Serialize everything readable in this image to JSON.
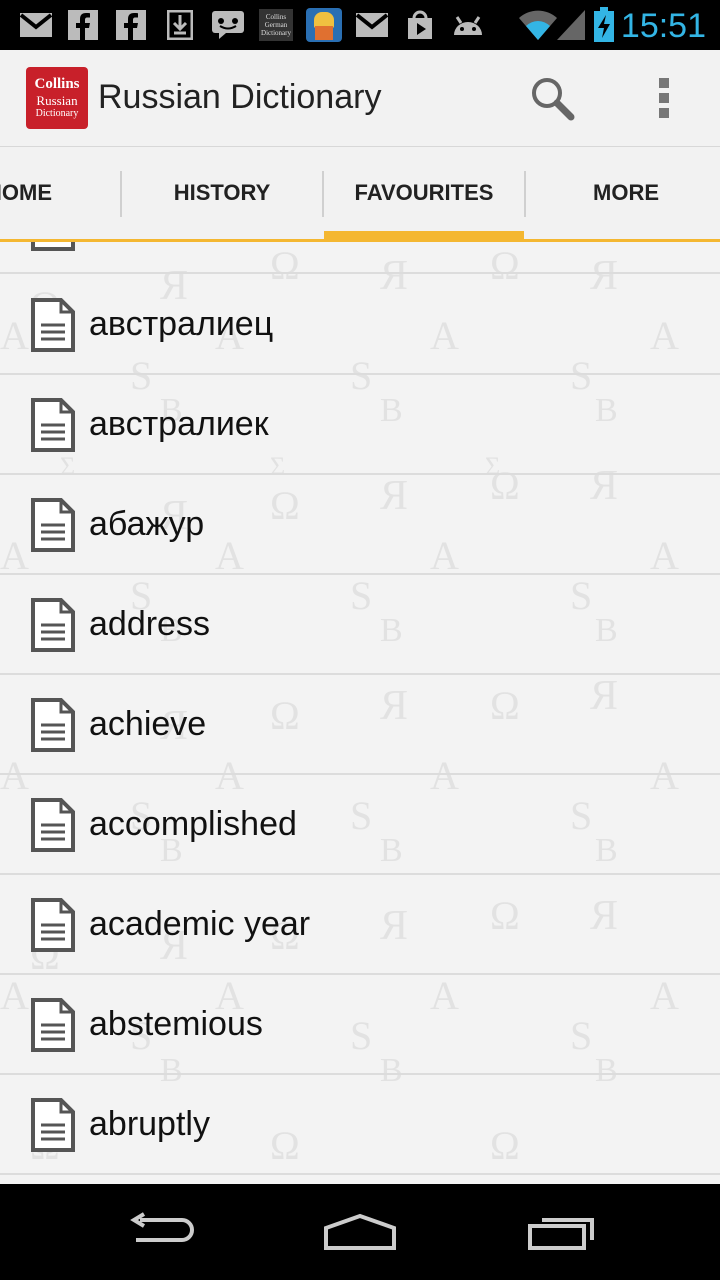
{
  "status_bar": {
    "time": "15:51",
    "notification_icons": [
      "gmail-icon",
      "facebook-icon",
      "facebook-icon",
      "download-icon",
      "chat-icon",
      "collins-german-icon",
      "game-icon",
      "gmail-icon",
      "play-store-icon",
      "android-icon"
    ],
    "collins_icon_text": [
      "Collins",
      "German",
      "Dictionary"
    ]
  },
  "action_bar": {
    "logo": {
      "line1": "Collins",
      "line2": "Russian",
      "line3": "Dictionary"
    },
    "title": "Russian Dictionary"
  },
  "tabs": [
    {
      "label": "HOME",
      "selected": false
    },
    {
      "label": "HISTORY",
      "selected": false
    },
    {
      "label": "FAVOURITES",
      "selected": true
    },
    {
      "label": "MORE",
      "selected": false
    }
  ],
  "favourites": [
    {
      "word": ""
    },
    {
      "word": "австралиец"
    },
    {
      "word": "австралиек"
    },
    {
      "word": "абажур"
    },
    {
      "word": "address"
    },
    {
      "word": "achieve"
    },
    {
      "word": "accomplished"
    },
    {
      "word": "academic year"
    },
    {
      "word": "abstemious"
    },
    {
      "word": "abruptly"
    }
  ],
  "colors": {
    "accent": "#f4b731",
    "status_time": "#33b5e5",
    "logo_red": "#c8202a"
  }
}
